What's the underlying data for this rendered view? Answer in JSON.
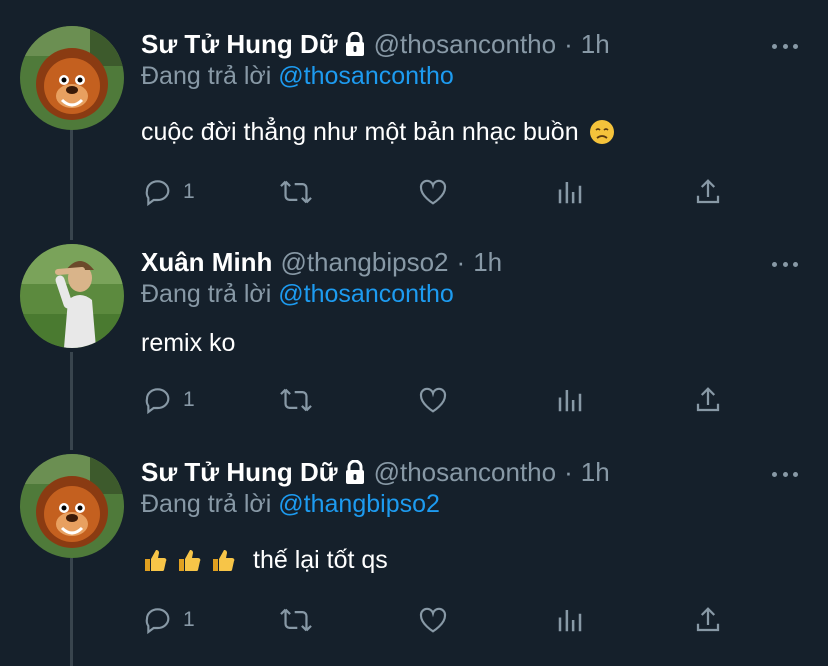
{
  "tweets": [
    {
      "name": "Sư Tử Hung Dữ",
      "locked": true,
      "handle": "@thosancontho",
      "separator": "·",
      "time": "1h",
      "reply_prefix": "Đang trả lời",
      "reply_to": "@thosancontho",
      "text": "cuộc đời thẳng như một bản nhạc buồn",
      "text_emoji": "disappointed-face",
      "reply_count": "1",
      "avatar": "lion-avatar"
    },
    {
      "name": "Xuân Minh",
      "locked": false,
      "handle": "@thangbipso2",
      "separator": "·",
      "time": "1h",
      "reply_prefix": "Đang trả lời",
      "reply_to": "@thosancontho",
      "text": "remix ko",
      "reply_count": "1",
      "avatar": "person-photo-avatar"
    },
    {
      "name": "Sư Tử Hung Dữ",
      "locked": true,
      "handle": "@thosancontho",
      "separator": "·",
      "time": "1h",
      "reply_prefix": "Đang trả lời",
      "reply_to": "@thangbipso2",
      "text": "thế lại tốt qs",
      "text_emoji_prefix": "thumbs-up x3",
      "reply_count": "1",
      "avatar": "lion-avatar"
    }
  ],
  "colors": {
    "background": "#15202b",
    "secondary_text": "#8899a6",
    "link": "#1d9bf0",
    "thread_line": "#38444d"
  },
  "action_icons": [
    "reply-icon",
    "retweet-icon",
    "like-icon",
    "analytics-icon",
    "share-icon"
  ]
}
